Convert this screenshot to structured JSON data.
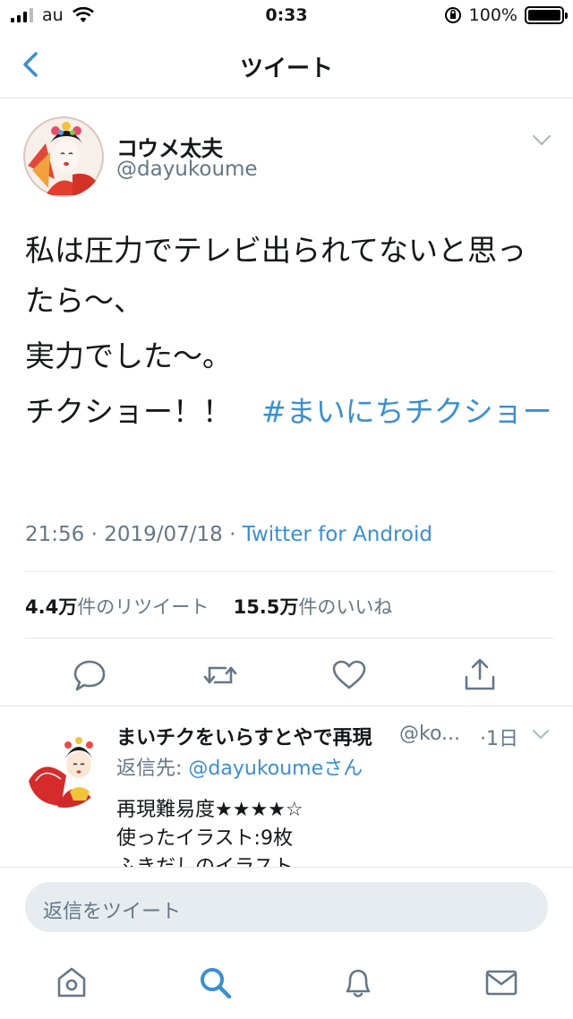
{
  "status_bar": {
    "carrier": "au",
    "time": "0:33",
    "battery": "100%"
  },
  "nav": {
    "title": "ツイート"
  },
  "tweet": {
    "author_name": "コウメ太夫",
    "author_handle": "@dayukoume",
    "lines": [
      "私は圧力でテレビ出られてないと思ったら〜、",
      "実力でした〜。"
    ],
    "last_line_text": "チクショー！！　",
    "hashtag": "#まいにちチクショー",
    "time": "21:56 · 2019/07/18 · ",
    "via": "Twitter for Android",
    "retweet_count": "4.4万",
    "retweet_label": "件のリツイート",
    "like_count": "15.5万",
    "like_label": "件のいいね"
  },
  "reply": {
    "name": "まいチクをいらすとやで再現",
    "handle": "@ko...",
    "time": "·1日",
    "to_label": "返信先: ",
    "to_mention": "@dayukoumeさん",
    "lines": [
      "再現難易度★★★★☆",
      "使ったイラスト:9枚",
      "ふきだしのイラスト"
    ]
  },
  "compose": {
    "placeholder": "返信をツイート"
  },
  "icons": {
    "back": "chevron-left-icon",
    "reply": "reply-icon",
    "retweet": "retweet-icon",
    "like": "heart-icon",
    "share": "share-icon",
    "home": "home-icon",
    "search": "search-icon",
    "notifications": "bell-icon",
    "messages": "mail-icon"
  },
  "colors": {
    "accent": "#3a8fd0",
    "muted": "#657786"
  }
}
